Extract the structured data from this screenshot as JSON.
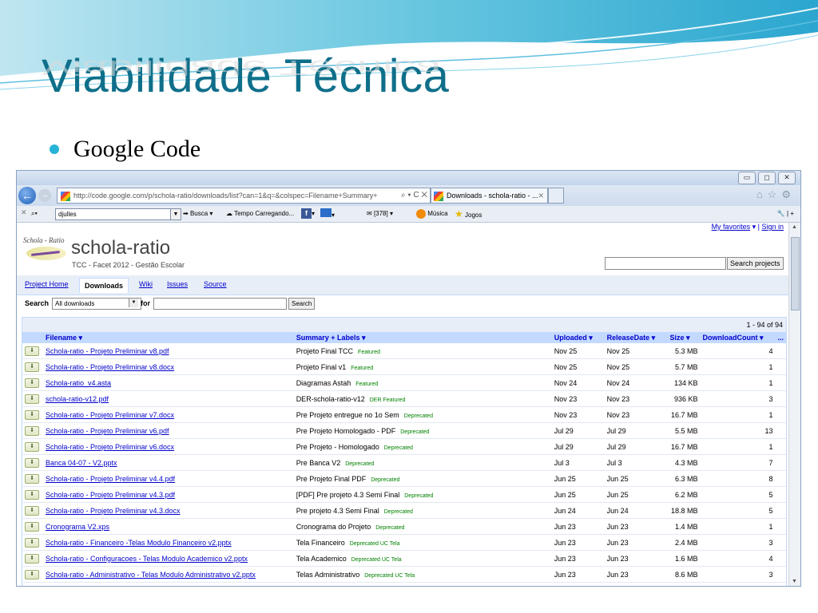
{
  "slide": {
    "title": "Viabilidade Técnica",
    "bullet": "Google Code"
  },
  "browser": {
    "url": "http://code.google.com/p/schola-ratio/downloads/list?can=1&q=&colspec=Filename+Summary+",
    "url_controls": "⌕ ▾ C ✕",
    "tab_title": "Downloads - schola-ratio - ...",
    "toolbar": {
      "user_field": "djulles",
      "busca": "Busca",
      "tempo": "Tempo Carregando...",
      "count": "[378]",
      "musica": "Música",
      "jogos": "Jogos"
    }
  },
  "page": {
    "user_links": {
      "favorites": "My favorites",
      "sep": "|",
      "signin": "Sign in"
    },
    "logo_text": "Schola - Ratio",
    "project_name": "schola-ratio",
    "project_summary": "TCC - Facet 2012 - Gestão Escolar",
    "search_projects_label": "Search projects",
    "tabs": [
      "Project Home",
      "Downloads",
      "Wiki",
      "Issues",
      "Source"
    ],
    "filter": {
      "search_label": "Search",
      "select_value": "All downloads",
      "for_label": "for",
      "button": "Search"
    },
    "count_text": "1 - 94 of 94",
    "columns": [
      "Filename ▾",
      "Summary + Labels ▾",
      "Uploaded ▾",
      "ReleaseDate ▾",
      "Size ▾",
      "DownloadCount ▾",
      "..."
    ],
    "rows": [
      {
        "file": "Schola-ratio - Projeto Preliminar v8.pdf",
        "summary": "Projeto Final TCC",
        "label": "Featured",
        "uploaded": "Nov 25",
        "release": "Nov 25",
        "size": "5.3 MB",
        "count": "4"
      },
      {
        "file": "Schola-ratio - Projeto Preliminar v8.docx",
        "summary": "Projeto Final v1",
        "label": "Featured",
        "uploaded": "Nov 25",
        "release": "Nov 25",
        "size": "5.7 MB",
        "count": "1"
      },
      {
        "file": "Schola-ratio_v4.asta",
        "summary": "Diagramas Astah",
        "label": "Featured",
        "uploaded": "Nov 24",
        "release": "Nov 24",
        "size": "134 KB",
        "count": "1"
      },
      {
        "file": "schola-ratio-v12.pdf",
        "summary": "DER-schola-ratio-v12",
        "label": "DER Featured",
        "uploaded": "Nov 23",
        "release": "Nov 23",
        "size": "936 KB",
        "count": "3"
      },
      {
        "file": "Schola-ratio - Projeto Preliminar v7.docx",
        "summary": "Pre Projeto entregue no 1o Sem",
        "label": "Deprecated",
        "uploaded": "Nov 23",
        "release": "Nov 23",
        "size": "16.7 MB",
        "count": "1"
      },
      {
        "file": "Schola-ratio - Projeto Preliminar v6.pdf",
        "summary": "Pre Projeto Homologado - PDF",
        "label": "Deprecated",
        "uploaded": "Jul 29",
        "release": "Jul 29",
        "size": "5.5 MB",
        "count": "13"
      },
      {
        "file": "Schola-ratio - Projeto Preliminar v6.docx",
        "summary": "Pre Projeto - Homologado",
        "label": "Deprecated",
        "uploaded": "Jul 29",
        "release": "Jul 29",
        "size": "16.7 MB",
        "count": "1"
      },
      {
        "file": "Banca 04-07 - V2.pptx",
        "summary": "Pre Banca V2",
        "label": "Deprecated",
        "uploaded": "Jul 3",
        "release": "Jul 3",
        "size": "4.3 MB",
        "count": "7"
      },
      {
        "file": "Schola-ratio - Projeto Preliminar v4.4.pdf",
        "summary": "Pre Projeto Final PDF",
        "label": "Deprecated",
        "uploaded": "Jun 25",
        "release": "Jun 25",
        "size": "6.3 MB",
        "count": "8"
      },
      {
        "file": "Schola-ratio - Projeto Preliminar v4.3.pdf",
        "summary": "[PDF] Pre projeto 4.3 Semi Final",
        "label": "Deprecated",
        "uploaded": "Jun 25",
        "release": "Jun 25",
        "size": "6.2 MB",
        "count": "5"
      },
      {
        "file": "Schola-ratio - Projeto Preliminar v4.3.docx",
        "summary": "Pre projeto 4.3 Semi Final",
        "label": "Deprecated",
        "uploaded": "Jun 24",
        "release": "Jun 24",
        "size": "18.8 MB",
        "count": "5"
      },
      {
        "file": "Cronograma V2.xps",
        "summary": "Cronograma do Projeto",
        "label": "Deprecated",
        "uploaded": "Jun 23",
        "release": "Jun 23",
        "size": "1.4 MB",
        "count": "1"
      },
      {
        "file": "Schola-ratio - Financeiro -Telas Modulo Financeiro v2.pptx",
        "summary": "Tela Financeiro",
        "label": "Deprecated UC Tela",
        "uploaded": "Jun 23",
        "release": "Jun 23",
        "size": "2.4 MB",
        "count": "3"
      },
      {
        "file": "Schola-ratio - Configuracoes - Telas Modulo Academico v2.pptx",
        "summary": "Tela Academico",
        "label": "Deprecated UC Tela",
        "uploaded": "Jun 23",
        "release": "Jun 23",
        "size": "1.6 MB",
        "count": "4"
      },
      {
        "file": "Schola-ratio - Administrativo - Telas Modulo Administrativo v2.pptx",
        "summary": "Telas Administrativo",
        "label": "Deprecated UC Tela",
        "uploaded": "Jun 23",
        "release": "Jun 23",
        "size": "8.6 MB",
        "count": "3"
      }
    ]
  },
  "colors": {
    "title": "#0f6f8a",
    "bullet": "#27b3d6",
    "link": "#0000cc",
    "label": "#008000",
    "header_bg": "#c3d9ff"
  }
}
